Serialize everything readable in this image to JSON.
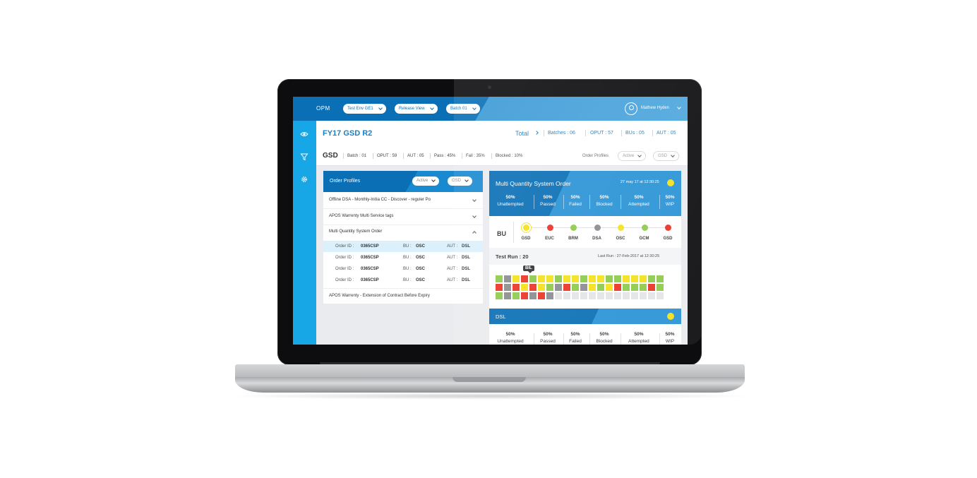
{
  "app": {
    "logo": "OPM",
    "filters": [
      "Test Env GE1",
      "Release View",
      "Batch 01"
    ],
    "user": "Mathew Hyden"
  },
  "sidebar": {
    "icons": [
      "eye-icon",
      "filter-icon",
      "gear-icon"
    ]
  },
  "header": {
    "title": "FY17 GSD R2",
    "total_label": "Total",
    "stats": [
      "Batches : 06",
      "OPUT : 57",
      "BUs : 05",
      "AUT : 05"
    ]
  },
  "subheader": {
    "title": "GSD",
    "stats": [
      "Batch : 01",
      "OPUT : 59",
      "AUT : 05",
      "Pass : 45%",
      "Fail : 35%",
      "Blocked : 10%"
    ],
    "order_profiles_label": "Order Profiles",
    "status_filter": "Active",
    "bu_filter": "GSD"
  },
  "order_profiles": {
    "title": "Order Profiles",
    "status_filter": "Active",
    "bu_filter": "GSD",
    "items": [
      "Offline DSA - Monthly-Initia CC - Discover - reguler Po",
      "APOS Warrenty Multi Service tags",
      "Multi Quantity System Order"
    ],
    "orders": [
      {
        "id_label": "Order ID :",
        "id": "0365CSP",
        "bu_label": "BU :",
        "bu": "OSC",
        "aut_label": "AUT :",
        "aut": "DSL"
      },
      {
        "id_label": "Order ID :",
        "id": "0365CSP",
        "bu_label": "BU :",
        "bu": "OSC",
        "aut_label": "AUT :",
        "aut": "DSL"
      },
      {
        "id_label": "Order ID :",
        "id": "0365CSP",
        "bu_label": "BU :",
        "bu": "OSC",
        "aut_label": "AUT :",
        "aut": "DSL"
      },
      {
        "id_label": "Order ID :",
        "id": "0365CSP",
        "bu_label": "BU :",
        "bu": "OSC",
        "aut_label": "AUT :",
        "aut": "DSL"
      }
    ],
    "last_item": "APOS Warrenty - Extension of Contract Before Expiry"
  },
  "detail": {
    "title": "Multi Quantity System Order",
    "date": "27 may 17 at 12:30:25",
    "status_color": "#f4e11b",
    "metrics": [
      {
        "value": "50%",
        "label": "Unattempted"
      },
      {
        "value": "50%",
        "label": "Passed"
      },
      {
        "value": "50%",
        "label": "Failed"
      },
      {
        "value": "50%",
        "label": "Blocked"
      },
      {
        "value": "50%",
        "label": "Attempted"
      },
      {
        "value": "50%",
        "label": "WIP"
      }
    ],
    "bu_title": "BU",
    "bus": [
      {
        "name": "GSD",
        "color": "#f4e11b",
        "selected": true
      },
      {
        "name": "EUC",
        "color": "#ea3324",
        "selected": false
      },
      {
        "name": "BRM",
        "color": "#8ccb4a",
        "selected": false
      },
      {
        "name": "DSA",
        "color": "#8a8c8f",
        "selected": false
      },
      {
        "name": "OSC",
        "color": "#f4e11b",
        "selected": false
      },
      {
        "name": "GCM",
        "color": "#8ccb4a",
        "selected": false
      },
      {
        "name": "GSD",
        "color": "#ea3324",
        "selected": false
      }
    ],
    "test_run": "Test Run : 20",
    "last_run_label": "Last Run :",
    "last_run": "27-Feb-2017 at 12:30:25",
    "tooltip": "BIL",
    "colors": {
      "g": "#8ccb4a",
      "y": "#f4e11b",
      "r": "#ea3324",
      "d": "#8a8c8f",
      "e": "#e3e4e6"
    },
    "heatmap": [
      "gdyrgyygyygyyggyyygg",
      "rdryrygdrgdygyrgggrg",
      "gdgrdrdeeeeeeeeeeeee"
    ]
  },
  "dsl": {
    "title": "DSL",
    "status_color": "#f4e11b",
    "metrics": [
      {
        "value": "50%",
        "label": "Unattempted"
      },
      {
        "value": "50%",
        "label": "Passed"
      },
      {
        "value": "50%",
        "label": "Failed"
      },
      {
        "value": "50%",
        "label": "Blocked"
      },
      {
        "value": "50%",
        "label": "Attempted"
      },
      {
        "value": "50%",
        "label": "WIP"
      }
    ]
  }
}
